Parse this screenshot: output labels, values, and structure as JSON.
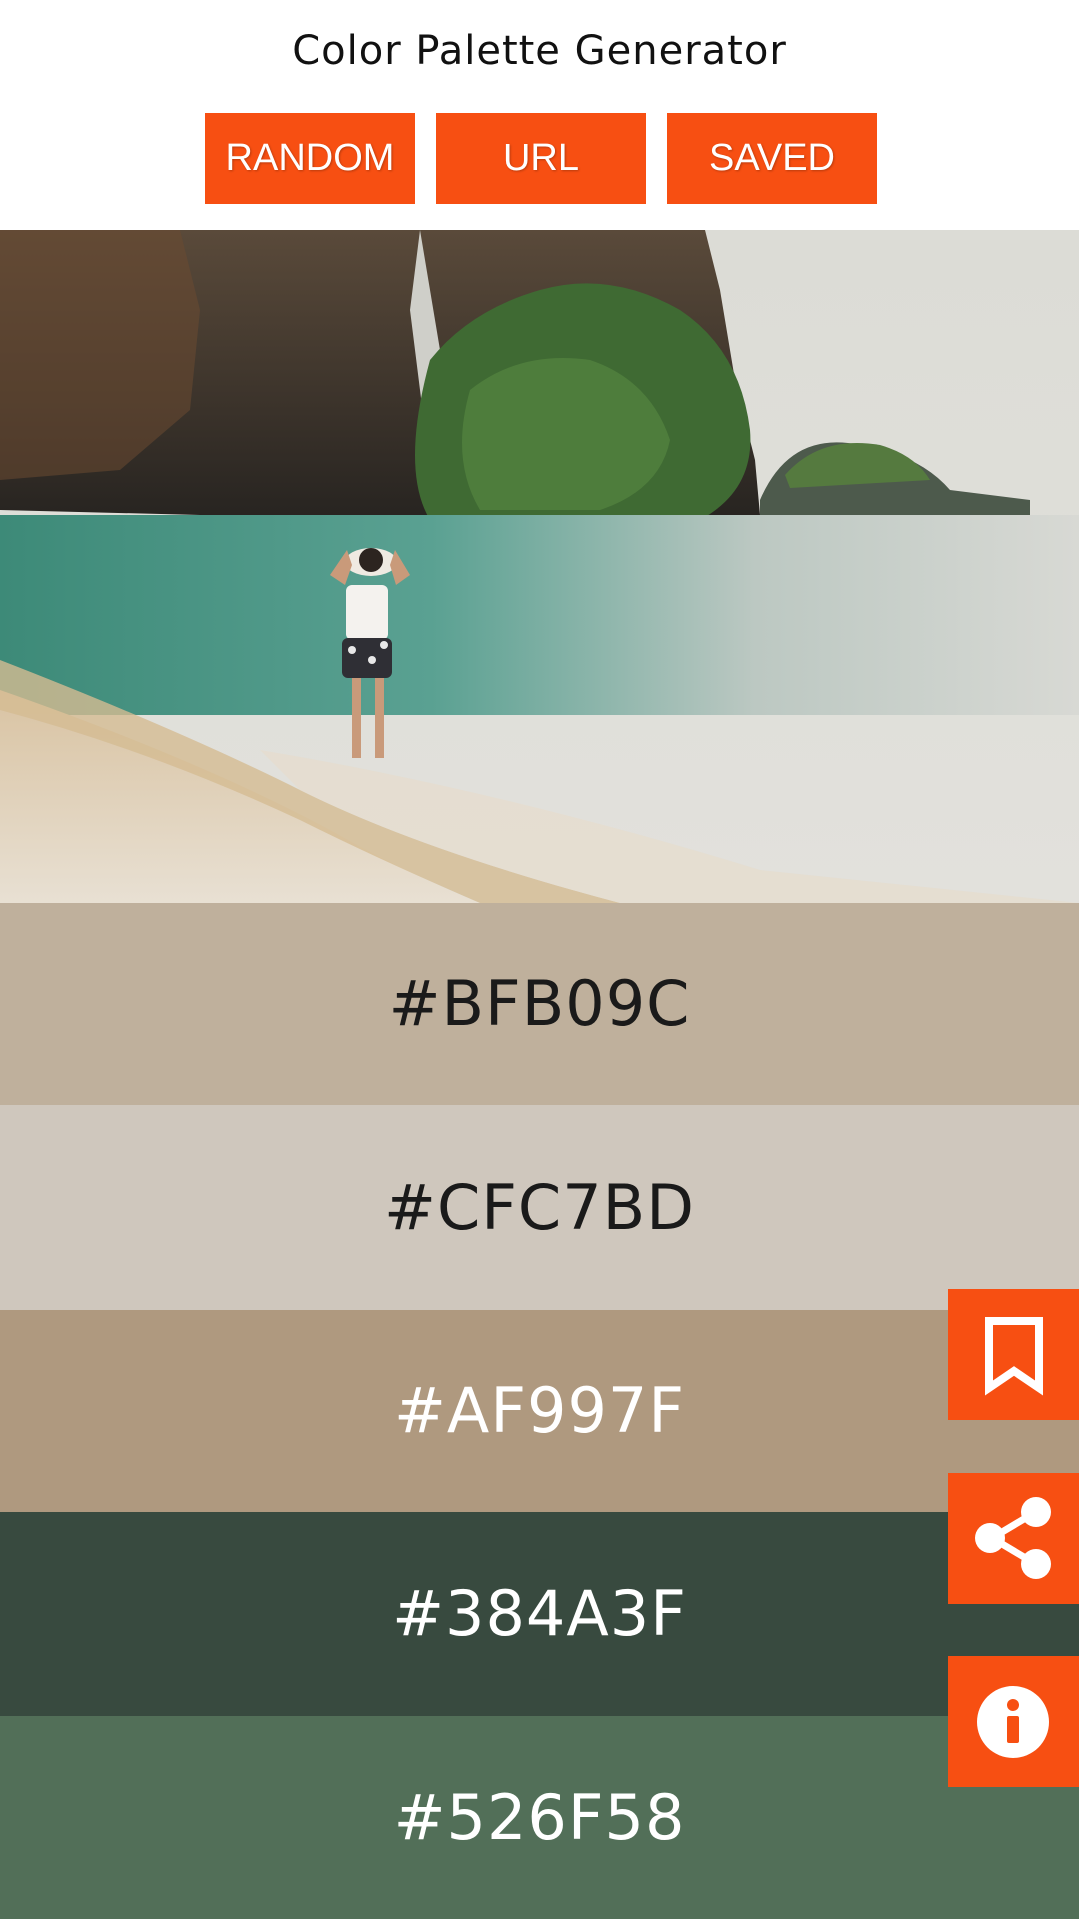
{
  "app": {
    "title": "Color Palette Generator"
  },
  "toolbar": {
    "random_label": "RANDOM",
    "url_label": "URL",
    "saved_label": "SAVED"
  },
  "theme": {
    "accent": "#F74F12"
  },
  "palette": [
    {
      "hex": "#BFB09C"
    },
    {
      "hex": "#CFC7BD"
    },
    {
      "hex": "#AF997F"
    },
    {
      "hex": "#384A3F"
    },
    {
      "hex": "#526F58"
    }
  ],
  "fabs": {
    "save_icon": "bookmark-icon",
    "share_icon": "share-icon",
    "info_icon": "info-icon"
  }
}
